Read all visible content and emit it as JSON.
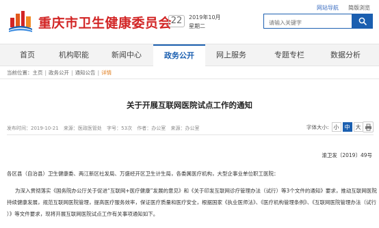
{
  "header": {
    "site_title": "重庆市卫生健康委员会",
    "logo_icon": "chongqing-skyline-logo-icon",
    "date_day": "22",
    "date_year_month": "2019年10月",
    "date_weekday": "星期二",
    "top_links": [
      "网站导航",
      "简版浏览"
    ],
    "search": {
      "placeholder": "请输入关键字",
      "button_icon": "search-icon"
    }
  },
  "nav": {
    "items": [
      {
        "label": "首页"
      },
      {
        "label": "机构职能"
      },
      {
        "label": "新闻中心"
      },
      {
        "label": "政务公开",
        "active": true
      },
      {
        "label": "网上服务"
      },
      {
        "label": "专题专栏"
      },
      {
        "label": "数据分析"
      }
    ]
  },
  "breadcrumb": {
    "prefix": "当前位置：",
    "items": [
      "主页",
      "政务公开",
      "通知公告"
    ],
    "current": "详情",
    "separator": "|"
  },
  "article": {
    "title": "关于开展互联网医院试点工作的通知",
    "meta": {
      "publish_time": "发布时间：2019-10-21",
      "source": "来源：医政医管处",
      "word_count": "字号：53次",
      "author": "作者：办公室",
      "office": "来源：办公室"
    },
    "fontsize": {
      "label": "字体大小:",
      "options": [
        "小",
        "中",
        "大"
      ],
      "active_index": 1
    },
    "print_icon": "printer-icon",
    "doc_number": "渝卫发〔2019〕49号",
    "addressee": "各区县（自治县）卫生健康委、两江新区社发局、万盛经开区卫生计生局，各委属医疗机构，大型企事业单位职工医院：",
    "body_lines": [
      "为深入贯彻落实《国务院办公厅关于促进“互联网+医疗健康”发展的意见》和《关于印发互联网诊疗管理办法（试行）等3个文件的通知》要求，推动互联网医院",
      "持续健康发展，规范互联网医院管理，提高医疗服务效率，保证医疗质量和医疗安全，根据国家《执业医师法》、《医疗机构管理条例》、《互联网医院管理办法（试行",
      "）》等文件要求，现将开展互联网医院试点工作有关事项通知如下。"
    ]
  },
  "colors": {
    "brand_red": "#d22525",
    "brand_blue": "#1b5fb0",
    "breadcrumb_current": "#e07b1a"
  }
}
